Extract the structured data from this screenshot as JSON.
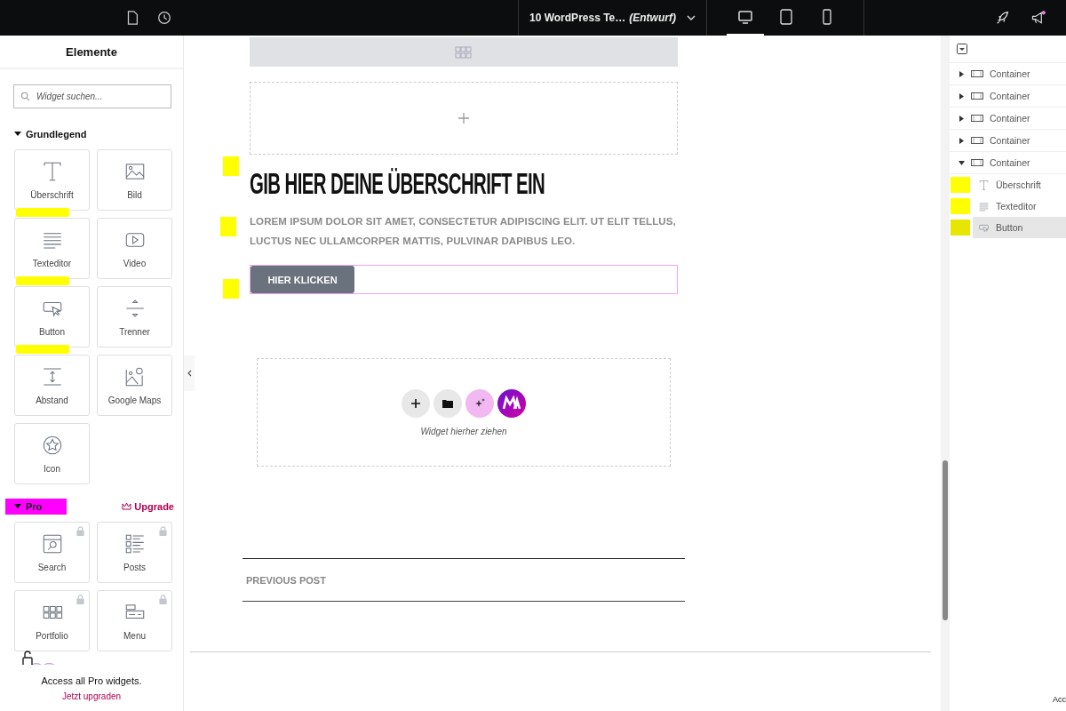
{
  "top_bar": {
    "document_title": "10 WordPress Te…",
    "status": "(Entwurf)",
    "devices": [
      {
        "kind": "desktop",
        "selected": true
      },
      {
        "kind": "tablet",
        "selected": false
      },
      {
        "kind": "mobile",
        "selected": false
      }
    ]
  },
  "elements_panel": {
    "title": "Elemente",
    "search": {
      "placeholder": "Widget suchen..."
    },
    "sections": [
      {
        "title": "Grundlegend",
        "highlighted": false,
        "widgets": [
          {
            "label": "Überschrift",
            "highlighted": true,
            "locked": false
          },
          {
            "label": "Bild",
            "highlighted": false,
            "locked": false
          },
          {
            "label": "Texteditor",
            "highlighted": true,
            "locked": false
          },
          {
            "label": "Video",
            "highlighted": false,
            "locked": false
          },
          {
            "label": "Button",
            "highlighted": true,
            "locked": false
          },
          {
            "label": "Trenner",
            "highlighted": false,
            "locked": false
          },
          {
            "label": "Abstand",
            "highlighted": false,
            "locked": false
          },
          {
            "label": "Google Maps",
            "highlighted": false,
            "locked": false
          },
          {
            "label": "Icon",
            "highlighted": false,
            "locked": false
          }
        ]
      },
      {
        "title": "Pro",
        "highlighted": true,
        "upgrade": "Upgrade",
        "widgets": [
          {
            "label": "Search",
            "highlighted": false,
            "locked": true
          },
          {
            "label": "Posts",
            "highlighted": false,
            "locked": true
          },
          {
            "label": "Portfolio",
            "highlighted": false,
            "locked": true
          },
          {
            "label": "Menu",
            "highlighted": false,
            "locked": true
          }
        ]
      }
    ],
    "promo": {
      "text": "Access all Pro widgets.",
      "link": "Jetzt upgraden"
    }
  },
  "canvas": {
    "heading": {
      "text": "GIB HIER DEINE ÜBERSCHRIFT EIN",
      "highlighted": true
    },
    "paragraph": {
      "text": "LOREM IPSUM DOLOR SIT AMET, CONSECTETUR ADIPISCING ELIT. UT ELIT TELLUS, LUCTUS NEC ULLAMCORPER MATTIS, PULVINAR DAPIBUS LEO.",
      "highlighted": true
    },
    "button": {
      "label": "HIER KLICKEN",
      "highlighted": true,
      "selected": true
    },
    "drop_zone": {
      "hint": "Widget hierher ziehen"
    },
    "post_nav": {
      "previous": "PREVIOUS POST"
    }
  },
  "navigator": {
    "items": [
      {
        "label": "Container",
        "expanded": false,
        "selected": false
      },
      {
        "label": "Container",
        "expanded": false,
        "selected": false
      },
      {
        "label": "Container",
        "expanded": false,
        "selected": false
      },
      {
        "label": "Container",
        "expanded": false,
        "selected": false
      },
      {
        "label": "Container",
        "expanded": true,
        "selected": false,
        "children": [
          {
            "label": "Überschrift",
            "selected": false,
            "highlighted": true
          },
          {
            "label": "Texteditor",
            "selected": false,
            "highlighted": true
          },
          {
            "label": "Button",
            "selected": true,
            "highlighted": true
          }
        ]
      }
    ],
    "footer_text": "Acc"
  }
}
